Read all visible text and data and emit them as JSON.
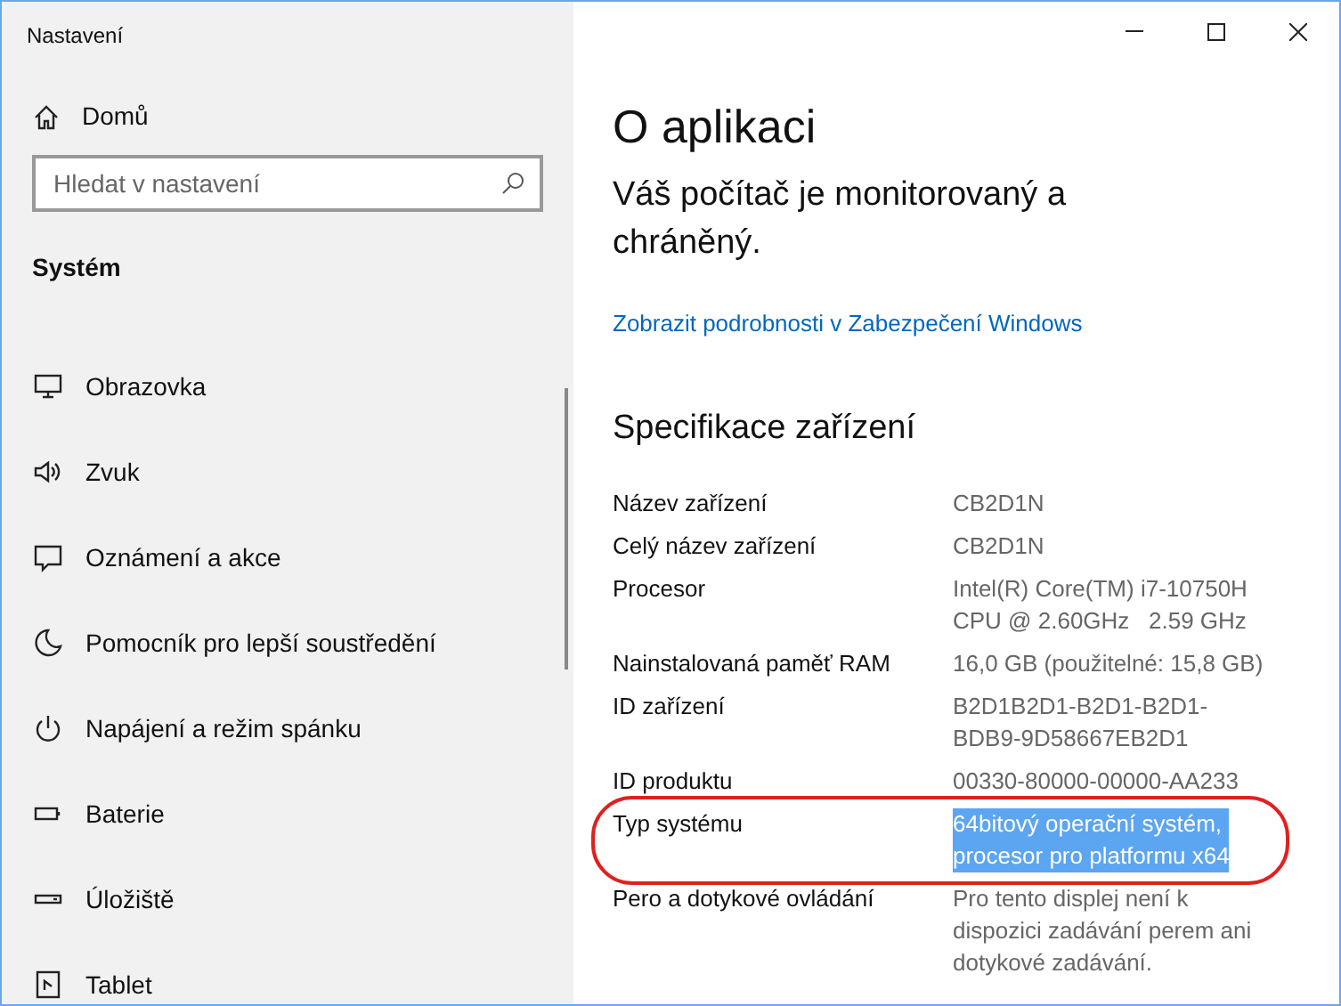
{
  "window": {
    "title": "Nastavení"
  },
  "sidebar": {
    "home": "Domů",
    "search": {
      "placeholder": "Hledat v nastavení"
    },
    "section": "Systém",
    "items": [
      {
        "label": "Obrazovka",
        "kind": "monitor"
      },
      {
        "label": "Zvuk",
        "kind": "speaker"
      },
      {
        "label": "Oznámení a akce",
        "kind": "message"
      },
      {
        "label": "Pomocník pro lepší soustředění",
        "kind": "moon"
      },
      {
        "label": "Napájení a režim spánku",
        "kind": "power"
      },
      {
        "label": "Baterie",
        "kind": "battery"
      },
      {
        "label": "Úložiště",
        "kind": "drive"
      },
      {
        "label": "Tablet",
        "kind": "tablet"
      }
    ]
  },
  "content": {
    "title": "O aplikaci",
    "status": "Váš počítač je monitorovaný a chráněný.",
    "link": "Zobrazit podrobnosti v Zabezpečení Windows",
    "section": "Specifikace zařízení",
    "specs": [
      {
        "label": "Název zařízení",
        "value": [
          "CB2D1N"
        ],
        "selected": false,
        "circled": false
      },
      {
        "label": "Celý název zařízení",
        "value": [
          "CB2D1N"
        ],
        "selected": false,
        "circled": false
      },
      {
        "label": "Procesor",
        "value": [
          "Intel(R) Core(TM) i7-10750H",
          "CPU @ 2.60GHz   2.59 GHz"
        ],
        "selected": false,
        "circled": false
      },
      {
        "label": "Nainstalovaná paměť RAM",
        "value": [
          "16,0 GB (použitelné: 15,8 GB)"
        ],
        "selected": false,
        "circled": false
      },
      {
        "label": "ID zařízení",
        "value": [
          "B2D1B2D1-B2D1-B2D1-",
          "BDB9-9D58667EB2D1"
        ],
        "selected": false,
        "circled": false
      },
      {
        "label": "ID produktu",
        "value": [
          "00330-80000-00000-AA233"
        ],
        "selected": false,
        "circled": false
      },
      {
        "label": "Typ systému",
        "value": [
          "64bitový operační systém,",
          "procesor pro platformu x64"
        ],
        "selected": true,
        "circled": true
      },
      {
        "label": "Pero a dotykové ovládání",
        "value": [
          "Pro tento displej není k",
          "dispozici zadávání perem ani",
          "dotykové zadávání."
        ],
        "selected": false,
        "circled": false
      }
    ]
  }
}
